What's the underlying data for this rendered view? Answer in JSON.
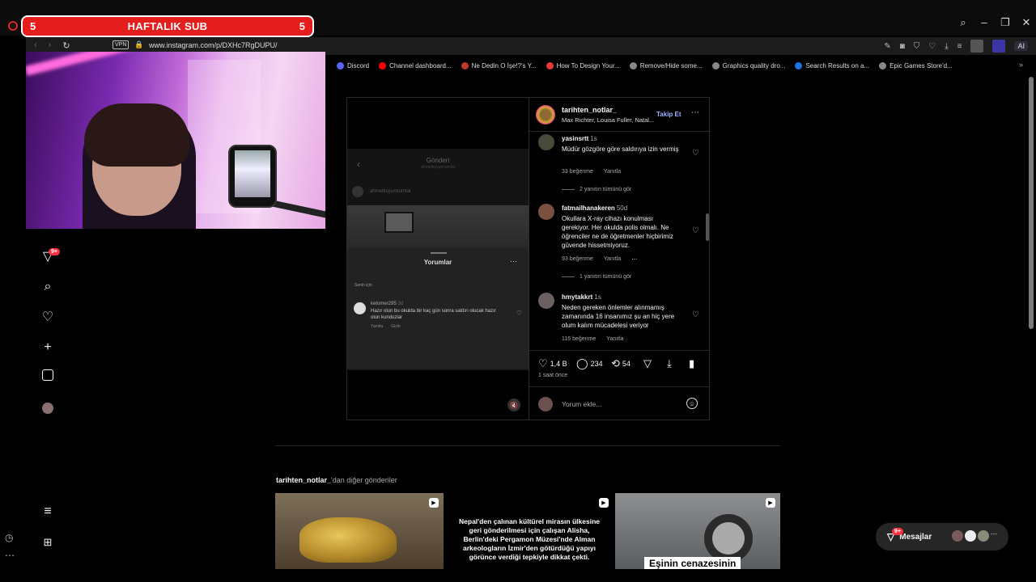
{
  "stream_banner": {
    "left_num": "5",
    "title": "HAFTALIK SUB",
    "right_num": "5"
  },
  "browser": {
    "url": "www.instagram.com/p/DXHc7RgDUPU/",
    "vpn": "VPN",
    "ai_label": "AI",
    "bookmarks": [
      {
        "label": "Discord",
        "color": "#5865f2"
      },
      {
        "label": "Channel dashboard...",
        "color": "#ff0000"
      },
      {
        "label": "Ne Dedin O İşe!?'s Y...",
        "color": "#c0392b"
      },
      {
        "label": "How To Design Your...",
        "color": "#e53935"
      },
      {
        "label": "Remove/Hide some...",
        "color": "#888888"
      },
      {
        "label": "Graphics quality dro...",
        "color": "#888888"
      },
      {
        "label": "Search Results on a...",
        "color": "#1b74e4"
      },
      {
        "label": "Epic Games Store'd...",
        "color": "#888888"
      }
    ]
  },
  "nav": {
    "notif_badge": "9+"
  },
  "post": {
    "username": "tarihten_notlar_",
    "music": "Max Richter, Louisa Fuller, Natal...",
    "follow": "Takip Et",
    "media": {
      "header": "Gönderi",
      "header_sub": "ahmetkoyuncumtal",
      "header_user": "ahmetkoyuncumtal",
      "sheet_title": "Yorumlar",
      "sort": "Senin için",
      "comment_user": "ketomer295",
      "comment_time": "3d",
      "comment_text": "Hazır olun bu okulda bir kaç gün sonra saldırı olucak hazır olun kunduzlar",
      "reply": "Yanıtla",
      "hide": "Gizle"
    },
    "comments": [
      {
        "user": "yasinsrtt",
        "time": "1s",
        "text": "Müdür gözgöre göre saldırıya izin vermiş",
        "likes": "33 beğenme",
        "reply": "Yanıtla",
        "view_replies": "2 yanıtın tümünü gör"
      },
      {
        "user": "fatmailhanakeren",
        "time": "50d",
        "text": "Okullara X-ray cihazı konulması gerekiyor. Her okulda polis olmalı. Ne öğrenciler ne de öğretmenler hiçbirimiz güvende hissetmiyoruz.",
        "likes": "93 beğenme",
        "reply": "Yanıtla",
        "view_replies": "1 yanıtın tümünü gör"
      },
      {
        "user": "hmytakkrt",
        "time": "1s",
        "text": "Neden gereken önlemler alınmamış zamanında 16 insanımız şu an hiç yere olum kalım mücadelesi veriyor",
        "likes": "116 beğenme",
        "reply": "Yanıtla"
      }
    ],
    "stats": {
      "likes": "1,4 B",
      "comments": "234",
      "reposts": "54"
    },
    "ago": "1 saat önce",
    "composer_placeholder": "Yorum ekle..."
  },
  "more": {
    "user": "tarihten_notlar_",
    "suffix": "'dan diğer gönderiler",
    "thumb2_text": "Nepal'den çalınan kültürel mirasın ülkesine geri gönderilmesi için çalışan Alisha, Berlin'deki Pergamon Müzesi'nde Alman arkeologların İzmir'den götürdüğü yapıyı görünce verdiği tepkiyle dikkat çekti.",
    "thumb3_caption": "Eşinin cenazesinin"
  },
  "messages": {
    "label": "Mesajlar",
    "badge": "9+"
  }
}
